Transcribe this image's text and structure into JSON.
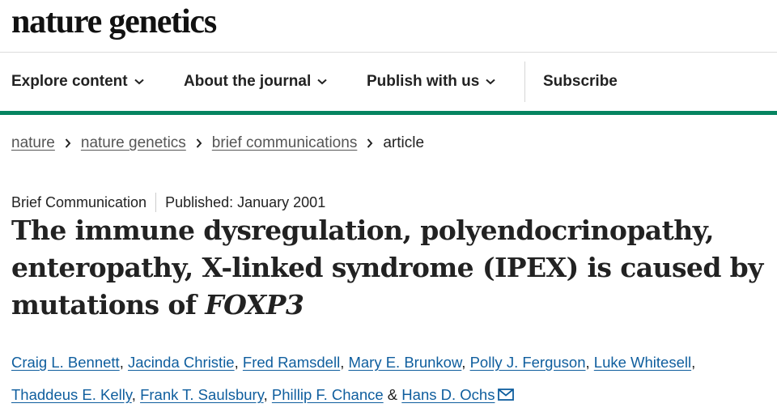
{
  "header": {
    "brand": "nature genetics"
  },
  "nav": {
    "items": [
      {
        "label": "Explore content"
      },
      {
        "label": "About the journal"
      },
      {
        "label": "Publish with us"
      }
    ],
    "subscribe": "Subscribe"
  },
  "breadcrumb": {
    "items": [
      "nature",
      "nature genetics",
      "brief communications"
    ],
    "current": "article"
  },
  "article": {
    "type": "Brief Communication",
    "published": "Published: January 2001",
    "title_main": "The immune dysregulation, polyendocrinopathy, enteropathy, X-linked syndrome (IPEX) is caused by mutations of ",
    "title_gene": "FOXP3",
    "authors": [
      "Craig L. Bennett",
      "Jacinda Christie",
      "Fred Ramsdell",
      "Mary E. Brunkow",
      "Polly J. Ferguson",
      "Luke Whitesell",
      "Thaddeus E. Kelly",
      "Frank T. Saulsbury",
      "Phillip F. Chance",
      "Hans D. Ochs"
    ],
    "separator_comma": ", ",
    "separator_and": " & "
  },
  "colors": {
    "accent": "#068460",
    "link": "#0f5e9e"
  },
  "icons": {
    "chevron": "chevron-down-icon",
    "crumb": "chevron-right-icon",
    "mail": "mail-icon"
  }
}
